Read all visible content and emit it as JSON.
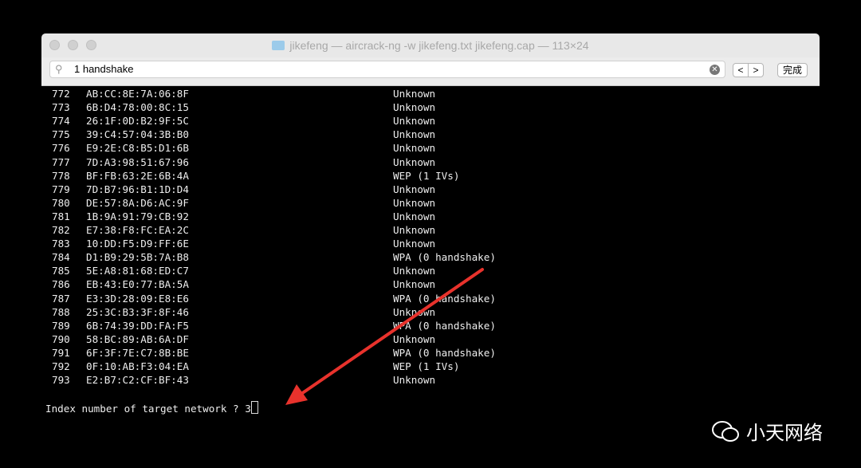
{
  "window": {
    "title": "jikefeng — aircrack-ng -w jikefeng.txt jikefeng.cap — 113×24"
  },
  "find": {
    "query": "1 handshake",
    "prev": "<",
    "next": ">",
    "done": "完成"
  },
  "rows": [
    [
      "772",
      "AB:CC:8E:7A:06:8F",
      "Unknown"
    ],
    [
      "773",
      "6B:D4:78:00:8C:15",
      "Unknown"
    ],
    [
      "774",
      "26:1F:0D:B2:9F:5C",
      "Unknown"
    ],
    [
      "775",
      "39:C4:57:04:3B:B0",
      "Unknown"
    ],
    [
      "776",
      "E9:2E:C8:B5:D1:6B",
      "Unknown"
    ],
    [
      "777",
      "7D:A3:98:51:67:96",
      "Unknown"
    ],
    [
      "778",
      "BF:FB:63:2E:6B:4A",
      "WEP (1 IVs)"
    ],
    [
      "779",
      "7D:B7:96:B1:1D:D4",
      "Unknown"
    ],
    [
      "780",
      "DE:57:8A:D6:AC:9F",
      "Unknown"
    ],
    [
      "781",
      "1B:9A:91:79:CB:92",
      "Unknown"
    ],
    [
      "782",
      "E7:38:F8:FC:EA:2C",
      "Unknown"
    ],
    [
      "783",
      "10:DD:F5:D9:FF:6E",
      "Unknown"
    ],
    [
      "784",
      "D1:B9:29:5B:7A:B8",
      "WPA (0 handshake)"
    ],
    [
      "785",
      "5E:A8:81:68:ED:C7",
      "Unknown"
    ],
    [
      "786",
      "EB:43:E0:77:BA:5A",
      "Unknown"
    ],
    [
      "787",
      "E3:3D:28:09:E8:E6",
      "WPA (0 handshake)"
    ],
    [
      "788",
      "25:3C:B3:3F:8F:46",
      "Unknown"
    ],
    [
      "789",
      "6B:74:39:DD:FA:F5",
      "WPA (0 handshake)"
    ],
    [
      "790",
      "58:BC:89:AB:6A:DF",
      "Unknown"
    ],
    [
      "791",
      "6F:3F:7E:C7:8B:BE",
      "WPA (0 handshake)"
    ],
    [
      "792",
      "0F:10:AB:F3:04:EA",
      "WEP (1 IVs)"
    ],
    [
      "793",
      "E2:B7:C2:CF:BF:43",
      "Unknown"
    ]
  ],
  "prompt": "Index number of target network ? 3",
  "watermark": "小天网络",
  "colors": {
    "arrow": "#e8322c",
    "terminal_bg": "#000000",
    "text": "#eeeeee"
  }
}
